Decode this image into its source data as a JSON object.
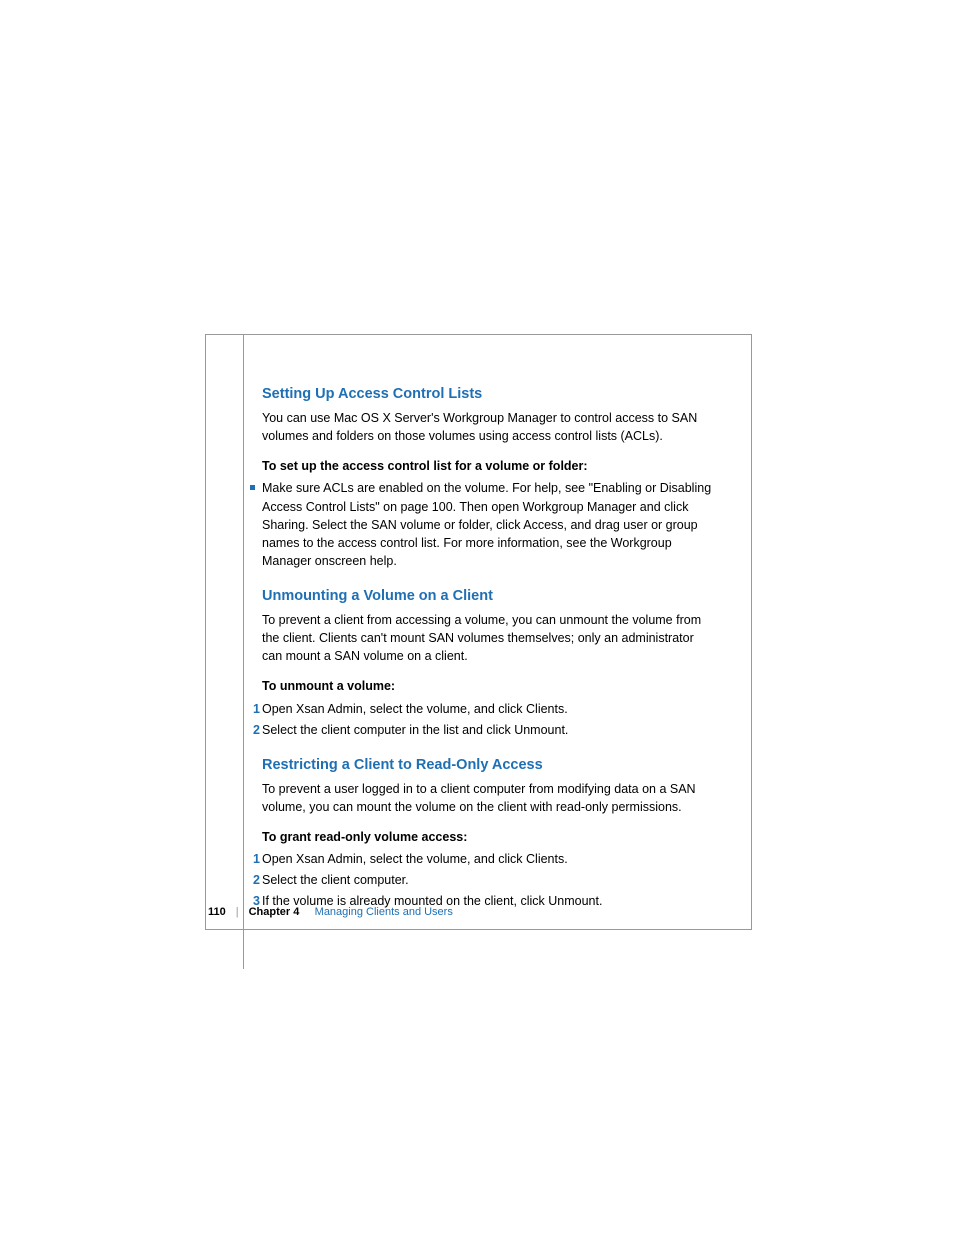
{
  "sections": {
    "s1": {
      "heading": "Setting Up Access Control Lists",
      "intro": "You can use Mac OS X Server's Workgroup Manager to control access to SAN volumes and folders on those volumes using access control lists (ACLs).",
      "lead": "To set up the access control list for a volume or folder:",
      "bullet": "Make sure ACLs are enabled on the volume. For help, see \"Enabling or Disabling Access Control Lists\" on page 100. Then open Workgroup Manager and click Sharing. Select the SAN volume or folder, click Access, and drag user or group names to the access control list. For more information, see the Workgroup Manager onscreen help."
    },
    "s2": {
      "heading": "Unmounting a Volume on a Client",
      "intro": "To prevent a client from accessing a volume, you can unmount the volume from the client. Clients can't mount SAN volumes themselves; only an administrator can mount a SAN volume on a client.",
      "lead": "To unmount a volume:",
      "steps": {
        "n1": "1",
        "t1": "Open Xsan Admin, select the volume, and click Clients.",
        "n2": "2",
        "t2": "Select the client computer in the list and click Unmount."
      }
    },
    "s3": {
      "heading": "Restricting a Client to Read-Only Access",
      "intro": "To prevent a user logged in to a client computer from modifying data on a SAN volume, you can mount the volume on the client with read-only permissions.",
      "lead": "To grant read-only volume access:",
      "steps": {
        "n1": "1",
        "t1": "Open Xsan Admin, select the volume, and click Clients.",
        "n2": "2",
        "t2": "Select the client computer.",
        "n3": "3",
        "t3": "If the volume is already mounted on the client, click Unmount."
      }
    }
  },
  "footer": {
    "page": "110",
    "chapter_label": "Chapter 4",
    "chapter_title": "Managing Clients and Users"
  }
}
